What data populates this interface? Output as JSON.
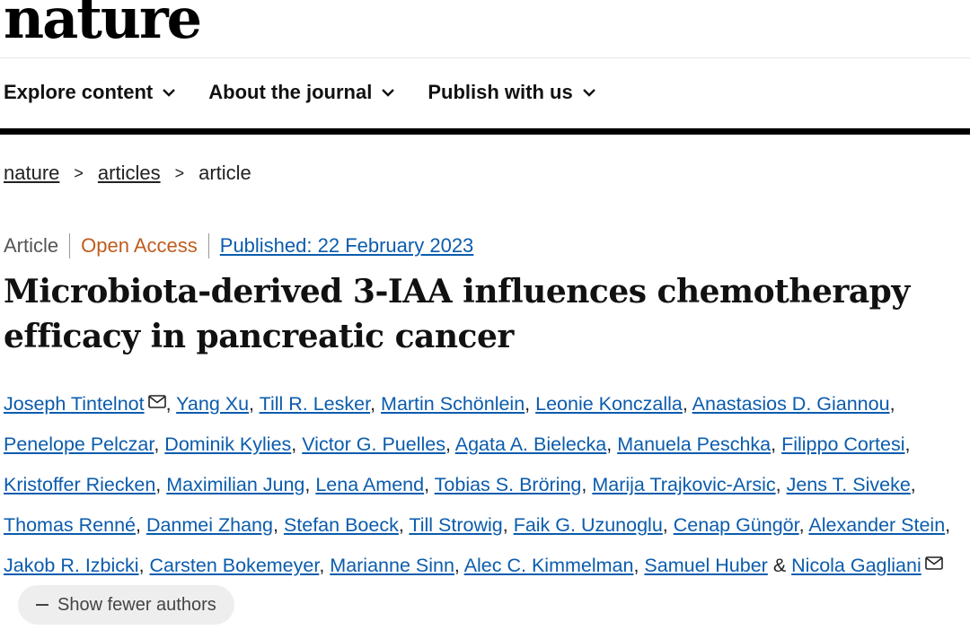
{
  "brand": {
    "logo": "nature"
  },
  "nav": {
    "items": [
      {
        "label": "Explore content",
        "icon": "chevron-down-icon"
      },
      {
        "label": "About the journal",
        "icon": "chevron-down-icon"
      },
      {
        "label": "Publish with us",
        "icon": "chevron-down-icon"
      }
    ]
  },
  "breadcrumb": {
    "items": [
      "nature",
      "articles",
      "article"
    ],
    "separator": ">"
  },
  "meta": {
    "type": "Article",
    "access": "Open Access",
    "published": "Published: 22 February 2023"
  },
  "article": {
    "title": "Microbiota-derived 3-IAA influences chemotherapy efficacy in pancreatic cancer",
    "authors": [
      "Joseph Tintelnot",
      "Yang Xu",
      "Till R. Lesker",
      "Martin Schönlein",
      "Leonie Konczalla",
      "Anastasios D. Giannou",
      "Penelope Pelczar",
      "Dominik Kylies",
      "Victor G. Puelles",
      "Agata A. Bielecka",
      "Manuela Peschka",
      "Filippo Cortesi",
      "Kristoffer Riecken",
      "Maximilian Jung",
      "Lena Amend",
      "Tobias S. Bröring",
      "Marija Trajkovic-Arsic",
      "Jens T. Siveke",
      "Thomas Renné",
      "Danmei Zhang",
      "Stefan Boeck",
      "Till Strowig",
      "Faik G. Uzunoglu",
      "Cenap Güngör",
      "Alexander Stein",
      "Jakob R. Izbicki",
      "Carsten Bokemeyer",
      "Marianne Sinn",
      "Alec C. Kimmelman",
      "Samuel Huber",
      "Nicola Gagliani"
    ],
    "author_sep": ", ",
    "last_sep": " & ",
    "show_fewer_label": "Show fewer authors"
  },
  "colors": {
    "link": "#0b5cad",
    "open_access": "#c05c1e",
    "rule": "#000000"
  }
}
